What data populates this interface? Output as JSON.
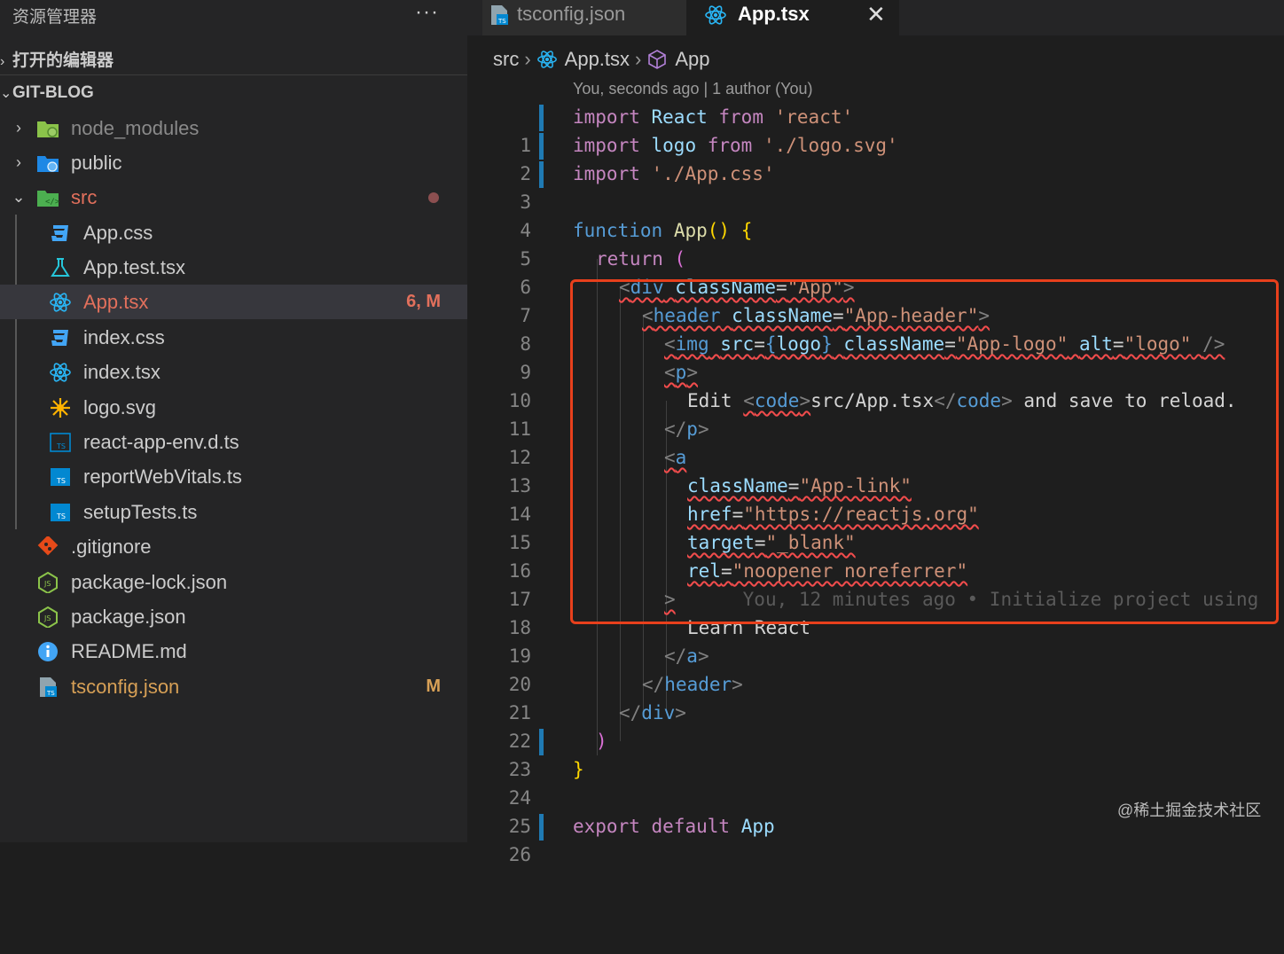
{
  "sidebar": {
    "title": "资源管理器",
    "more_label": "···",
    "open_editors_label": "打开的编辑器",
    "project_label": "GIT-BLOG",
    "tree": [
      {
        "name": "node_modules",
        "type": "folder",
        "expanded": false,
        "icon": "folder-node-icon"
      },
      {
        "name": "public",
        "type": "folder",
        "expanded": false,
        "icon": "folder-public-icon"
      },
      {
        "name": "src",
        "type": "folder",
        "expanded": true,
        "icon": "folder-src-icon",
        "status": "modified-dot"
      },
      {
        "name": "App.css",
        "icon": "css-file-icon"
      },
      {
        "name": "App.test.tsx",
        "icon": "test-flask-icon"
      },
      {
        "name": "App.tsx",
        "icon": "react-file-icon",
        "badge": "6, M",
        "selected": true
      },
      {
        "name": "index.css",
        "icon": "css-file-icon"
      },
      {
        "name": "index.tsx",
        "icon": "react-file-icon"
      },
      {
        "name": "logo.svg",
        "icon": "svg-sun-icon"
      },
      {
        "name": "react-app-env.d.ts",
        "icon": "typescript-def-icon"
      },
      {
        "name": "reportWebVitals.ts",
        "icon": "typescript-file-icon"
      },
      {
        "name": "setupTests.ts",
        "icon": "typescript-file-icon"
      },
      {
        "name": ".gitignore",
        "icon": "git-icon"
      },
      {
        "name": "package-lock.json",
        "icon": "nodejs-icon"
      },
      {
        "name": "package.json",
        "icon": "nodejs-icon"
      },
      {
        "name": "README.md",
        "icon": "info-icon"
      },
      {
        "name": "tsconfig.json",
        "icon": "tsconfig-icon",
        "badge": "M"
      }
    ]
  },
  "tabs": [
    {
      "label": "tsconfig.json",
      "icon": "tsconfig-icon",
      "active": false
    },
    {
      "label": "App.tsx",
      "icon": "react-file-icon",
      "active": true,
      "close": "✕"
    }
  ],
  "breadcrumb": {
    "folder": "src",
    "file": "App.tsx",
    "symbol": "App"
  },
  "codelens": "You, seconds ago | 1 author (You)",
  "code_lines": [
    {
      "n": "1"
    },
    {
      "n": "2"
    },
    {
      "n": "3"
    },
    {
      "n": "4"
    },
    {
      "n": "5"
    },
    {
      "n": "6"
    },
    {
      "n": "7"
    },
    {
      "n": "8"
    },
    {
      "n": "9"
    },
    {
      "n": "10"
    },
    {
      "n": "11"
    },
    {
      "n": "12"
    },
    {
      "n": "13"
    },
    {
      "n": "14"
    },
    {
      "n": "15"
    },
    {
      "n": "16"
    },
    {
      "n": "17"
    },
    {
      "n": "18"
    },
    {
      "n": "19"
    },
    {
      "n": "20"
    },
    {
      "n": "21"
    },
    {
      "n": "22"
    },
    {
      "n": "23"
    },
    {
      "n": "24"
    },
    {
      "n": "25"
    },
    {
      "n": "26"
    }
  ],
  "code": {
    "l1": [
      "import",
      " ",
      "React",
      " ",
      "from",
      " ",
      "'react'"
    ],
    "l2": [
      "import",
      " ",
      "logo",
      " ",
      "from",
      " ",
      "'./logo.svg'"
    ],
    "l3": [
      "import",
      " ",
      "'./App.css'"
    ],
    "l5": [
      "function",
      " ",
      "App",
      "()",
      " ",
      "{"
    ],
    "l6": [
      "return",
      " ",
      "("
    ],
    "l7": [
      "<",
      "div",
      " ",
      "className",
      "=",
      "\"App\"",
      ">"
    ],
    "l8": [
      "<",
      "header",
      " ",
      "className",
      "=",
      "\"App-header\"",
      ">"
    ],
    "l9": [
      "<",
      "img",
      " ",
      "src",
      "=",
      "{",
      "logo",
      "}",
      " ",
      "className",
      "=",
      "\"App-logo\"",
      " ",
      "alt",
      "=",
      "\"logo\"",
      " ",
      "/>"
    ],
    "l10": [
      "<",
      "p",
      ">"
    ],
    "l11": [
      "Edit ",
      "<",
      "code",
      ">",
      "src/App.tsx",
      "</",
      "code",
      ">",
      " and save to reload."
    ],
    "l12": [
      "</",
      "p",
      ">"
    ],
    "l13": [
      "<",
      "a"
    ],
    "l14": [
      "className",
      "=",
      "\"App-link\""
    ],
    "l15": [
      "href",
      "=",
      "\"https://reactjs.org\""
    ],
    "l16": [
      "target",
      "=",
      "\"_blank\""
    ],
    "l17": [
      "rel",
      "=",
      "\"noopener noreferrer\""
    ],
    "l18": [
      ">",
      "You, 12 minutes ago • Initialize project using"
    ],
    "l19": [
      "Learn React"
    ],
    "l20": [
      "</",
      "a",
      ">"
    ],
    "l21": [
      "</",
      "header",
      ">"
    ],
    "l22": [
      "</",
      "div",
      ">"
    ],
    "l23": [
      ")"
    ],
    "l24": [
      "}"
    ],
    "l26": [
      "export",
      " ",
      "default",
      " ",
      "App"
    ]
  },
  "watermark": "@稀土掘金技术社区",
  "colors": {
    "accent_red": "#e8401c",
    "modified": "#d7a056",
    "error": "#e2705c"
  }
}
